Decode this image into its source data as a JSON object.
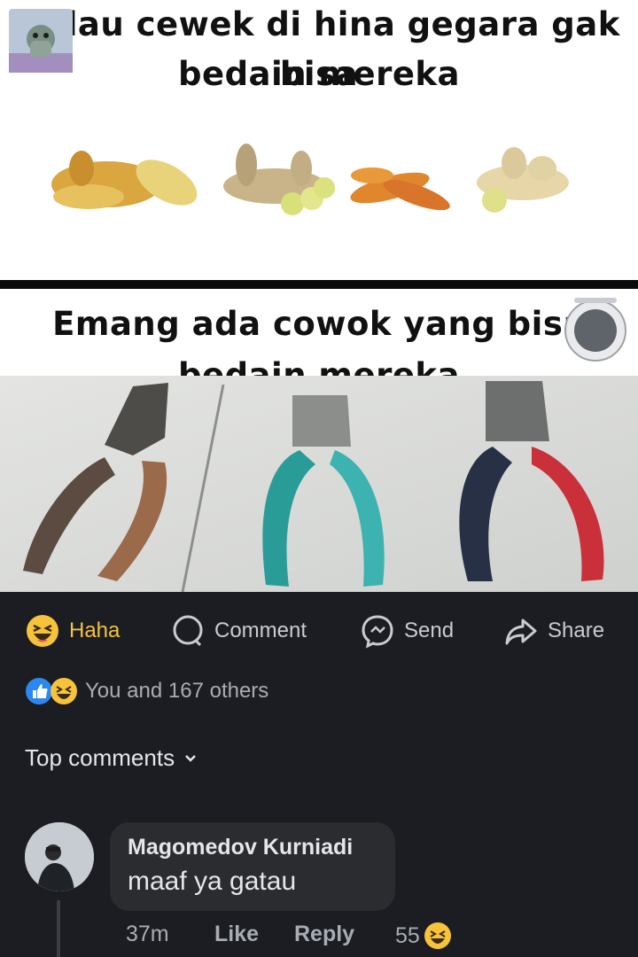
{
  "meme": {
    "top_caption_line1": "Kalau cewek di hina gegara gak bisa",
    "top_caption_line2": "bedain mereka",
    "bottom_caption_line1": "Emang ada cowok yang bisa",
    "bottom_caption_line2": "bedain mereka"
  },
  "actions": {
    "haha": "Haha",
    "comment": "Comment",
    "send": "Send",
    "share": "Share"
  },
  "reactions_summary": "You and 167 others",
  "top_comments_label": "Top comments",
  "comment": {
    "author": "Magomedov Kurniadi",
    "text": "maaf ya gatau",
    "time": "37m",
    "like": "Like",
    "reply": "Reply",
    "reaction_count": "55"
  }
}
